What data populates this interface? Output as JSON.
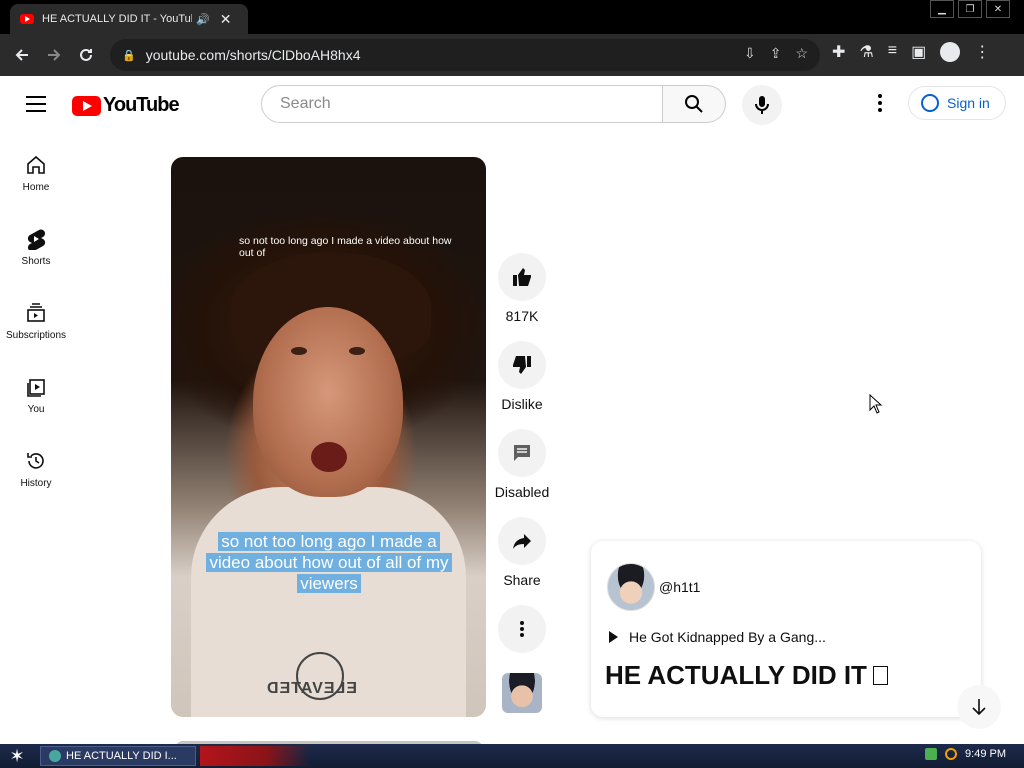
{
  "browser": {
    "tab_title": "HE ACTUALLY DID IT  - YouTub",
    "tab_audio_icon": "speaker-icon",
    "tab_close": "✕",
    "url": "youtube.com/shorts/ClDboAH8hx4",
    "window_controls": {
      "minimize": "▁",
      "restore": "❐",
      "close": "✕"
    }
  },
  "masthead": {
    "logo_text": "YouTube",
    "search_placeholder": "Search",
    "signin_label": "Sign in"
  },
  "sidebar": {
    "items": [
      {
        "label": "Home",
        "icon": "home-icon"
      },
      {
        "label": "Shorts",
        "icon": "shorts-icon"
      },
      {
        "label": "Subscriptions",
        "icon": "subscriptions-icon"
      },
      {
        "label": "You",
        "icon": "you-icon"
      },
      {
        "label": "History",
        "icon": "history-icon"
      }
    ]
  },
  "video": {
    "top_caption": "so not too long ago I made a video about how out of",
    "subtitle": "so not too long ago I made a video about how out of all of my viewers",
    "hoodie_text": "ELEVATED"
  },
  "actions": {
    "like_count": "817K",
    "dislike_label": "Dislike",
    "comments_label": "Disabled",
    "share_label": "Share"
  },
  "info": {
    "channel": "@h1t1",
    "playlist": "He Got Kidnapped By a Gang...",
    "title": "HE ACTUALLY DID IT"
  },
  "taskbar": {
    "task_label": "HE ACTUALLY DID I...",
    "clock": "9:49 PM"
  },
  "colors": {
    "youtube_red": "#ff0000",
    "signin_blue": "#065fd4",
    "caption_blue": "#6fb0e0"
  }
}
